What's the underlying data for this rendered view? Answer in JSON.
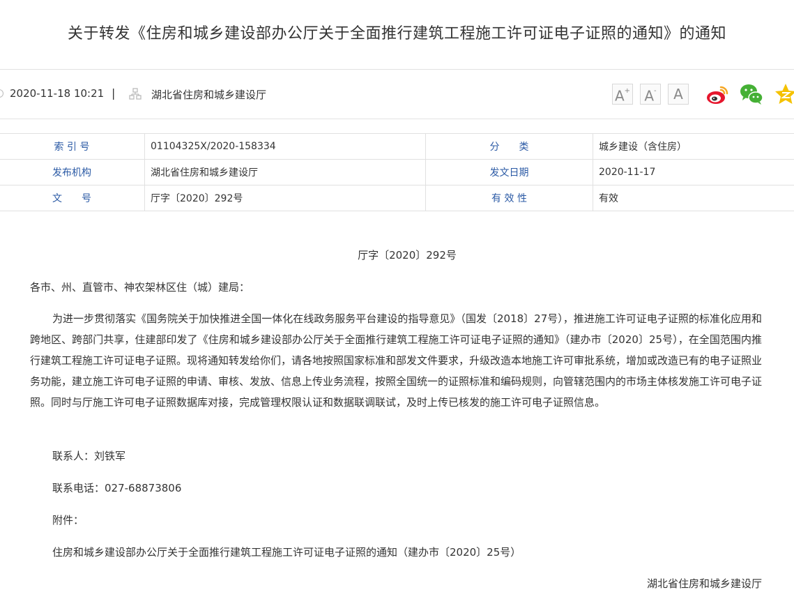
{
  "article": {
    "title": "关于转发《住房和城乡建设部办公厅关于全面推行建筑工程施工许可证电子证照的通知》的通知",
    "publish_time": "2020-11-18 10:21",
    "separator": "|",
    "source": "湖北省住房和城乡建设厅"
  },
  "toolbar": {
    "font_larger": "A",
    "font_larger_sup": "+",
    "font_smaller": "A",
    "font_smaller_sup": "-",
    "font_default": "A",
    "share_icons": [
      "weibo-icon",
      "wechat-icon",
      "qzone-icon"
    ],
    "colors": {
      "weibo": "#e6162d",
      "weibo_eye": "#f5a623",
      "wechat": "#45b035",
      "qzone": "#f5c200"
    }
  },
  "info_table": {
    "rows": [
      {
        "label1": "索 引 号",
        "value1": "01104325X/2020-158334",
        "label2": "分　　类",
        "value2": "城乡建设（含住房）"
      },
      {
        "label1": "发布机构",
        "value1": "湖北省住房和城乡建设厅",
        "label2": "发文日期",
        "value2": "2020-11-17"
      },
      {
        "label1": "文　　号",
        "value1": "厅字〔2020〕292号",
        "label2": "有 效 性",
        "value2": "有效"
      }
    ],
    "label_color": "#2b5aa5"
  },
  "body": {
    "doc_number": "厅字〔2020〕292号",
    "greeting": "各市、州、直管市、神农架林区住（城）建局：",
    "paragraph": "为进一步贯彻落实《国务院关于加快推进全国一体化在线政务服务平台建设的指导意见》（国发〔2018〕27号），推进施工许可证电子证照的标准化应用和跨地区、跨部门共享，住建部印发了《住房和城乡建设部办公厅关于全面推行建筑工程施工许可证电子证照的通知》（建办市〔2020〕25号），在全国范围内推行建筑工程施工许可证电子证照。现将通知转发给你们，请各地按照国家标准和部发文件要求，升级改造本地施工许可审批系统，增加或改造已有的电子证照业务功能，建立施工许可电子证照的申请、审核、发放、信息上传业务流程，按照全国统一的证照标准和编码规则，向管辖范围内的市场主体核发施工许可电子证照。同时与厅施工许可电子证照数据库对接，完成管理权限认证和数据联调联试，及时上传已核发的施工许可电子证照信息。",
    "contact": "联系人：刘铁军",
    "phone": "联系电话：027-68873806",
    "attachment_label": "附件：",
    "attachment": "住房和城乡建设部办公厅关于全面推行建筑工程施工许可证电子证照的通知（建办市〔2020〕25号）",
    "signature": "湖北省住房和城乡建设厅"
  }
}
